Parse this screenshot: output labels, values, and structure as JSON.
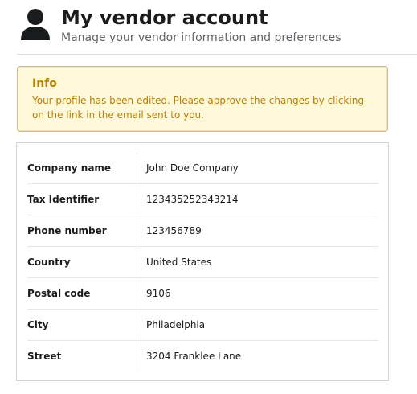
{
  "header": {
    "title": "My vendor account",
    "subtitle": "Manage your vendor information and preferences",
    "icon": "user-icon"
  },
  "info": {
    "title": "Info",
    "text": "Your profile has been edited. Please approve the changes by clicking on the link in the email sent to you.",
    "accent_color": "#b58105",
    "background_color": "#fff8db"
  },
  "details": {
    "rows": [
      {
        "label": "Company name",
        "value": "John Doe Company"
      },
      {
        "label": "Tax Identifier",
        "value": "123435252343214"
      },
      {
        "label": "Phone number",
        "value": "123456789"
      },
      {
        "label": "Country",
        "value": "United States"
      },
      {
        "label": "Postal code",
        "value": "9106"
      },
      {
        "label": "City",
        "value": "Philadelphia"
      },
      {
        "label": "Street",
        "value": "3204 Franklee Lane"
      }
    ]
  }
}
